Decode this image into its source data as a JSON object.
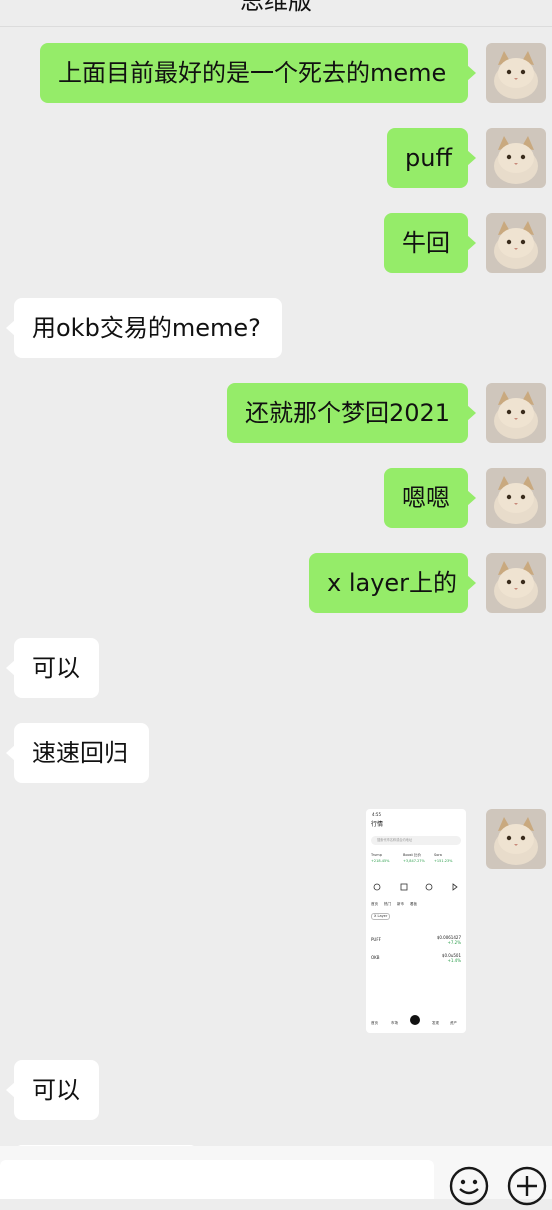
{
  "header": {
    "title": "思维版"
  },
  "messages": [
    {
      "dir": "out",
      "text": "上面目前最好的是一个死去的meme"
    },
    {
      "dir": "out",
      "text": "puff"
    },
    {
      "dir": "out",
      "text": "牛回"
    },
    {
      "dir": "in",
      "text": "用okb交易的meme?"
    },
    {
      "dir": "out",
      "text": "还就那个梦回2021"
    },
    {
      "dir": "out",
      "text": "嗯嗯"
    },
    {
      "dir": "out",
      "text": "x layer上的"
    },
    {
      "dir": "in",
      "text": "可以"
    },
    {
      "dir": "in",
      "text": "速速回归"
    },
    {
      "dir": "out",
      "type": "image"
    },
    {
      "dir": "in",
      "text": "可以"
    }
  ],
  "image_message": {
    "status_time": "4:55",
    "title": "行情",
    "search_placeholder": "搜索代币名称或合约地址",
    "columns": [
      "Trump",
      "Boost 比价",
      "Sora"
    ],
    "column_values": [
      "+218.45%",
      "+3,847.27%",
      "+151.23%"
    ],
    "tabs": [
      "首页",
      "热门",
      "新币",
      "看板"
    ],
    "filter": "X Layer",
    "rows": [
      {
        "name": "PUFF",
        "price": "$0.0061427",
        "change": "+7.2%"
      },
      {
        "name": "OKB",
        "price": "$0.0u501",
        "change": "+1.4%"
      }
    ],
    "nav": [
      "首页",
      "市场",
      "交易",
      "发现",
      "资产"
    ]
  },
  "input_bar": {
    "emoji_icon": "smile-icon",
    "plus_icon": "plus-icon"
  }
}
